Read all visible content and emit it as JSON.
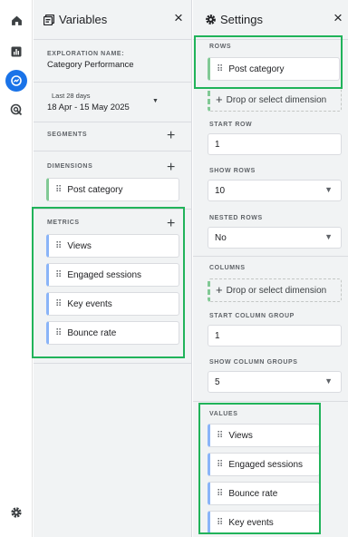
{
  "variables_panel": {
    "title": "Variables",
    "close": "×",
    "exploration_name_label": "EXPLORATION NAME:",
    "exploration_name": "Category Performance",
    "date_range_label": "Last 28 days",
    "date_range": "18 Apr - 15 May 2025",
    "segments_label": "SEGMENTS",
    "dimensions_label": "DIMENSIONS",
    "dimensions": [
      "Post category"
    ],
    "metrics_label": "METRICS",
    "metrics": [
      "Views",
      "Engaged sessions",
      "Key events",
      "Bounce rate"
    ]
  },
  "settings_panel": {
    "title": "Settings",
    "close": "×",
    "rows_label": "ROWS",
    "rows": [
      "Post category"
    ],
    "rows_dropzone": "Drop or select dimension",
    "start_row_label": "START ROW",
    "start_row": "1",
    "show_rows_label": "SHOW ROWS",
    "show_rows": "10",
    "nested_rows_label": "NESTED ROWS",
    "nested_rows": "No",
    "columns_label": "COLUMNS",
    "columns_dropzone": "Drop or select dimension",
    "start_column_group_label": "START COLUMN GROUP",
    "start_column_group": "1",
    "show_column_groups_label": "SHOW COLUMN GROUPS",
    "show_column_groups": "5",
    "values_label": "VALUES",
    "values": [
      "Views",
      "Engaged sessions",
      "Bounce rate",
      "Key events"
    ]
  },
  "icons": {
    "rail": [
      "home-icon",
      "reports-icon",
      "explore-icon",
      "advertising-icon",
      "admin-gear-icon"
    ],
    "add": "+",
    "grip": "⠿"
  },
  "colors": {
    "highlight": "#21b35a",
    "active_rail": "#1a73e8",
    "metric_accent": "#8ab4f8",
    "dimension_accent": "#81c995"
  }
}
